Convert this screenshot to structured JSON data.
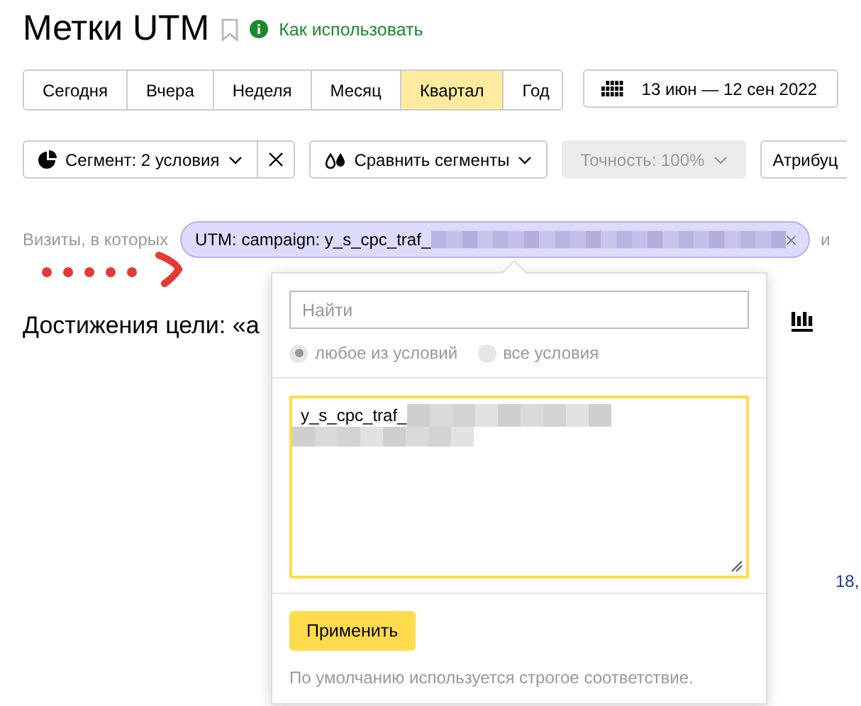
{
  "header": {
    "title": "Метки UTM",
    "help_link": "Как использовать"
  },
  "periods": [
    {
      "label": "Сегодня",
      "selected": false
    },
    {
      "label": "Вчера",
      "selected": false
    },
    {
      "label": "Неделя",
      "selected": false
    },
    {
      "label": "Месяц",
      "selected": false
    },
    {
      "label": "Квартал",
      "selected": true
    },
    {
      "label": "Год",
      "selected": false
    }
  ],
  "date_range": "13 июн — 12 сен 2022",
  "toolbar": {
    "segment": "Сегмент: 2 условия",
    "compare": "Сравнить сегменты",
    "accuracy": {
      "label": "Точность: 100%",
      "disabled": true
    },
    "attribution": "Атрибуц"
  },
  "filter": {
    "label": "Визиты, в которых",
    "chip": "UTM: campaign: y_s_cpc_traf_",
    "after": "и"
  },
  "goal_heading": "Достижения цели: «а",
  "chart_value": "18,",
  "popup": {
    "search_placeholder": "Найти",
    "modes": [
      {
        "label": "любое из условий",
        "selected": true
      },
      {
        "label": "все условия",
        "selected": false
      }
    ],
    "value": "y_s_cpc_traf_",
    "apply": "Применить",
    "note": "По умолчанию используется строгое соответствие."
  }
}
